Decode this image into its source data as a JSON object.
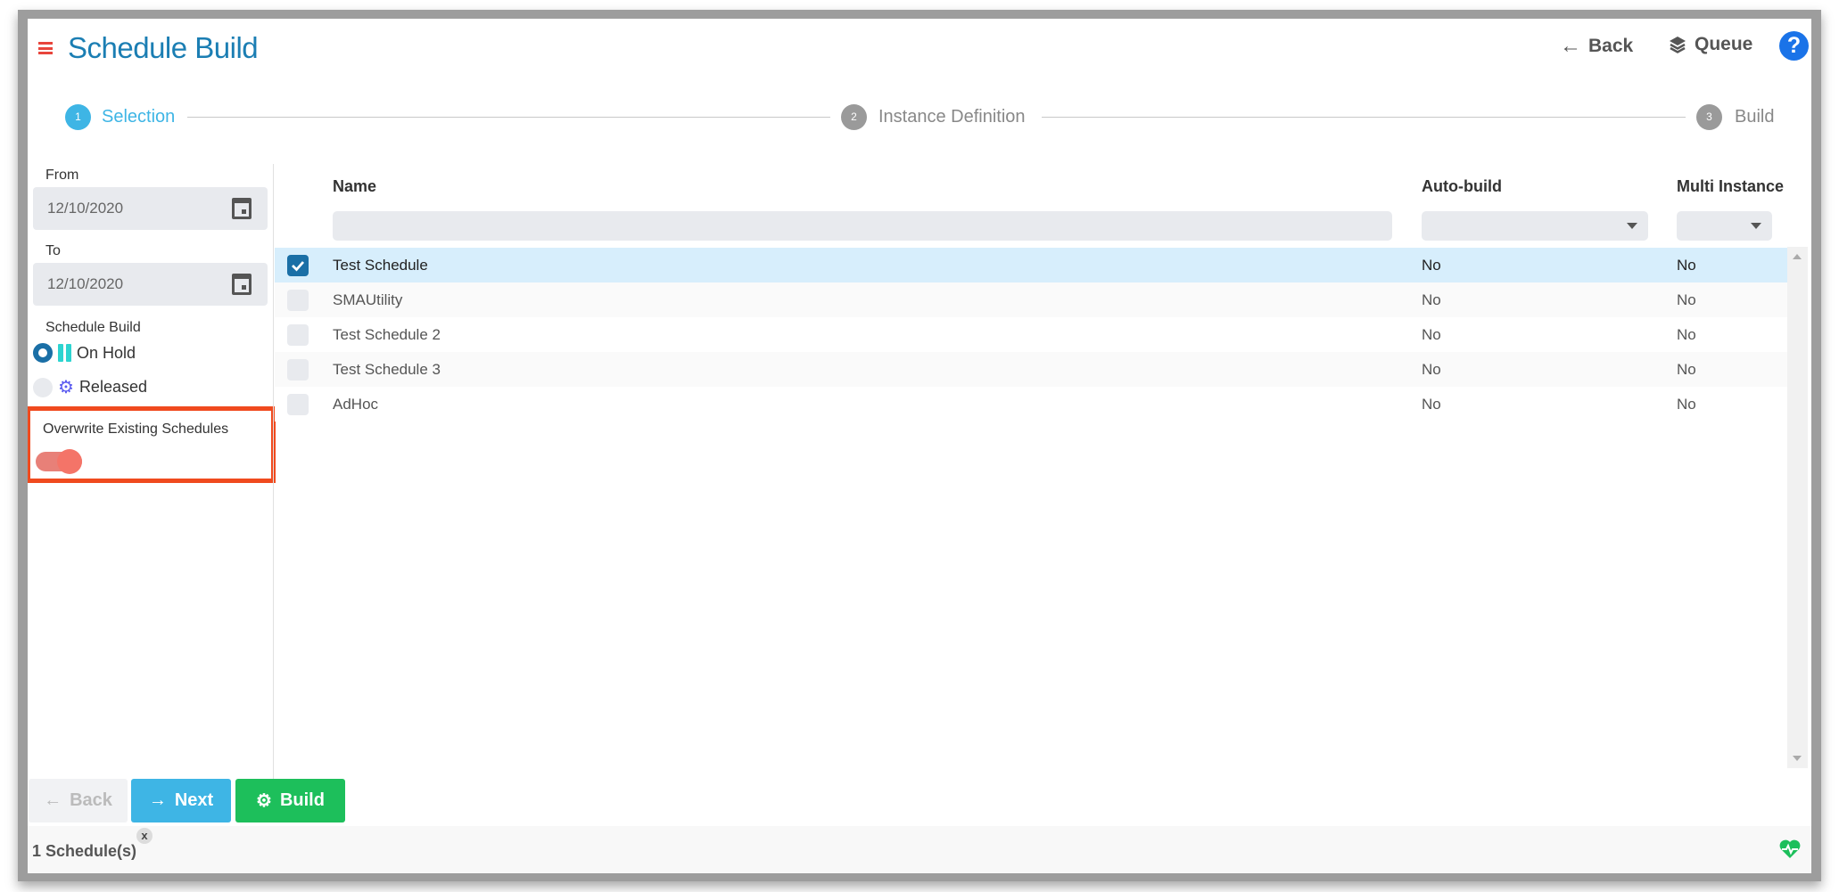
{
  "header": {
    "title": "Schedule Build",
    "back_label": "Back",
    "queue_label": "Queue",
    "help_label": "?"
  },
  "stepper": [
    {
      "number": "1",
      "label": "Selection",
      "state": "active"
    },
    {
      "number": "2",
      "label": "Instance Definition",
      "state": "inactive"
    },
    {
      "number": "3",
      "label": "Build",
      "state": "inactive"
    }
  ],
  "sidebar": {
    "from_label": "From",
    "from_value": "12/10/2020",
    "to_label": "To",
    "to_value": "12/10/2020",
    "schedule_build_label": "Schedule Build",
    "options": [
      {
        "label": "On Hold",
        "selected": true
      },
      {
        "label": "Released",
        "selected": false
      }
    ],
    "overwrite_label": "Overwrite Existing Schedules",
    "overwrite_on": true
  },
  "table": {
    "columns": [
      "Name",
      "Auto-build",
      "Multi Instance"
    ],
    "rows": [
      {
        "name": "Test Schedule",
        "auto_build": "No",
        "multi_instance": "No",
        "checked": true
      },
      {
        "name": "SMAUtility",
        "auto_build": "No",
        "multi_instance": "No",
        "checked": false
      },
      {
        "name": "Test Schedule 2",
        "auto_build": "No",
        "multi_instance": "No",
        "checked": false
      },
      {
        "name": "Test Schedule 3",
        "auto_build": "No",
        "multi_instance": "No",
        "checked": false
      },
      {
        "name": "AdHoc",
        "auto_build": "No",
        "multi_instance": "No",
        "checked": false
      }
    ]
  },
  "footer": {
    "back_label": "Back",
    "next_label": "Next",
    "build_label": "Build",
    "status_text": "1 Schedule(s)",
    "dismiss_label": "x"
  },
  "colors": {
    "accent": "#1b7eb3",
    "step_active": "#3eb5e5",
    "next_button": "#3eb5e5",
    "build_button": "#1dbf5b",
    "highlight_border": "#f04a1e",
    "toggle": "#f07068",
    "selected_row": "#d7eefc"
  }
}
